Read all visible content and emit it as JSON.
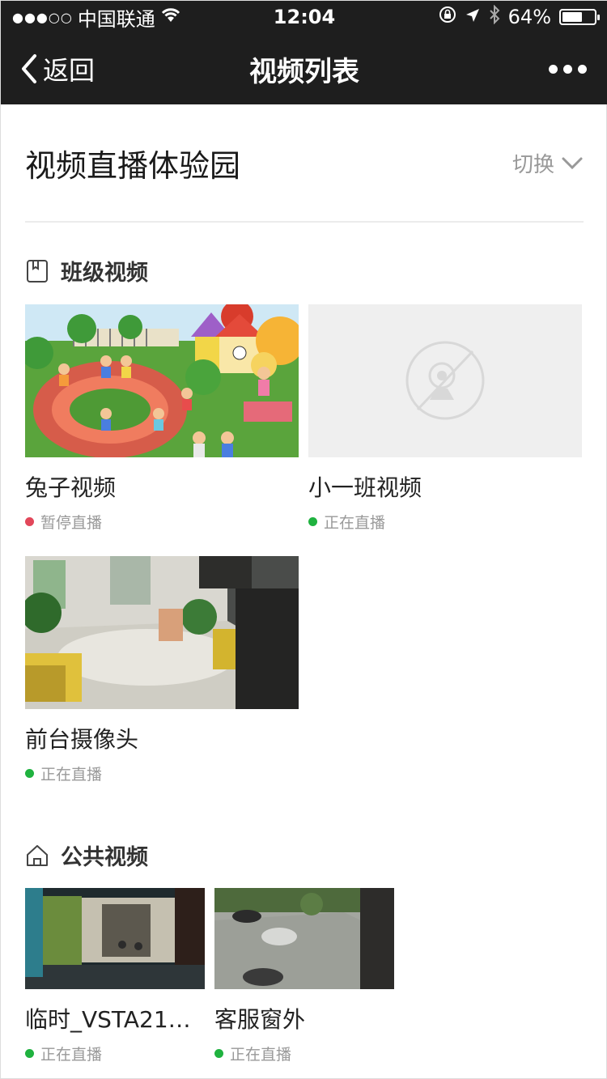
{
  "status_bar": {
    "signal": "●●●○○",
    "carrier": "中国联通",
    "time": "12:04",
    "battery": "64%",
    "battery_level": 0.64
  },
  "nav": {
    "back_label": "返回",
    "title": "视频列表"
  },
  "site": {
    "name": "视频直播体验园",
    "switch_label": "切换"
  },
  "sections": {
    "class": {
      "title": "班级视频",
      "items": [
        {
          "title": "兔子视频",
          "status": "暂停直播",
          "status_color": "#e2475a"
        },
        {
          "title": "小一班视频",
          "status": "正在直播",
          "status_color": "#1fb23f"
        },
        {
          "title": "前台摄像头",
          "status": "正在直播",
          "status_color": "#1fb23f"
        }
      ]
    },
    "public": {
      "title": "公共视频",
      "items": [
        {
          "title": "临时_VSTA21…",
          "status": "正在直播",
          "status_color": "#1fb23f"
        },
        {
          "title": "客服窗外",
          "status": "正在直播",
          "status_color": "#1fb23f"
        }
      ]
    }
  },
  "colors": {
    "bar_bg": "#1e1e1e",
    "live": "#1fb23f",
    "paused": "#e2475a"
  }
}
